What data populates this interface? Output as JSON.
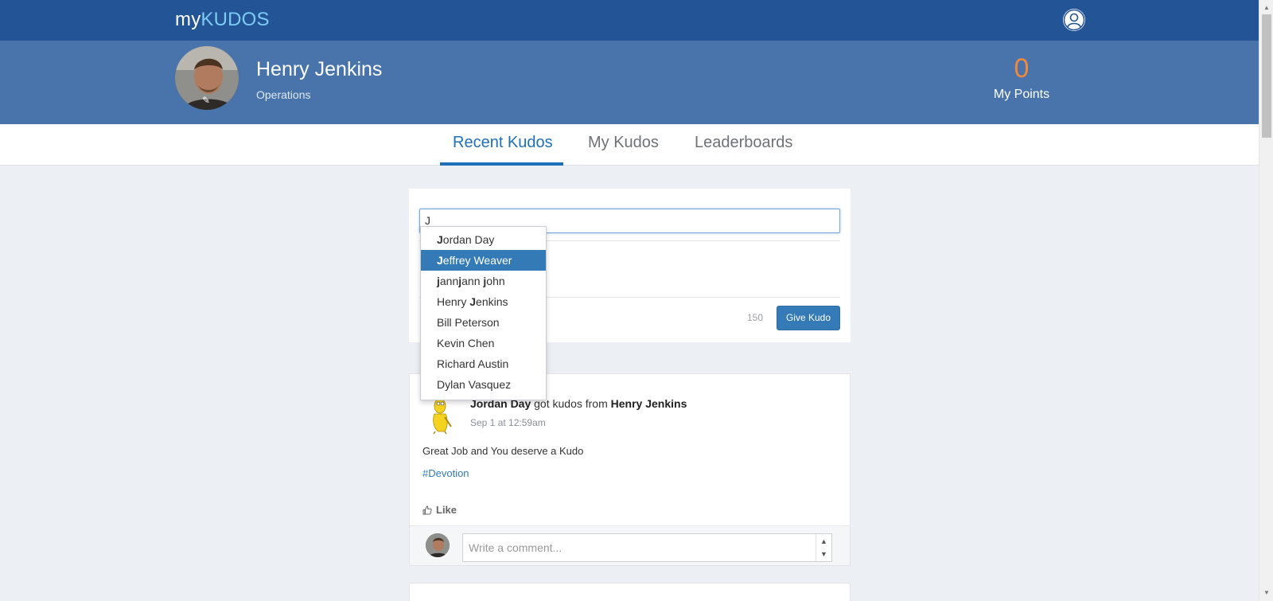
{
  "header": {
    "brand_prefix": "my",
    "brand_accent": "KUDOS",
    "user_icon": "user-circle-icon"
  },
  "profile": {
    "name": "Henry Jenkins",
    "department": "Operations",
    "points_value": "0",
    "points_label": "My Points",
    "edit_icon": "pencil-icon"
  },
  "tabs": [
    {
      "label": "Recent Kudos",
      "active": true
    },
    {
      "label": "My Kudos",
      "active": false
    },
    {
      "label": "Leaderboards",
      "active": false
    }
  ],
  "give_kudo": {
    "input_value": "J",
    "char_count": "150",
    "button_label": "Give Kudo"
  },
  "autocomplete": {
    "query": "J",
    "selected_index": 1,
    "items": [
      {
        "segments": [
          {
            "t": "J",
            "b": true
          },
          {
            "t": "ordan Day",
            "b": false
          }
        ]
      },
      {
        "segments": [
          {
            "t": "J",
            "b": true
          },
          {
            "t": "effrey Weaver",
            "b": false
          }
        ]
      },
      {
        "segments": [
          {
            "t": "j",
            "b": true
          },
          {
            "t": "ann",
            "b": false
          },
          {
            "t": "j",
            "b": true
          },
          {
            "t": "ann ",
            "b": false
          },
          {
            "t": "j",
            "b": true
          },
          {
            "t": "ohn",
            "b": false
          }
        ]
      },
      {
        "segments": [
          {
            "t": "Henry ",
            "b": false
          },
          {
            "t": "J",
            "b": true
          },
          {
            "t": "enkins",
            "b": false
          }
        ]
      },
      {
        "segments": [
          {
            "t": "Bill Peterson",
            "b": false
          }
        ]
      },
      {
        "segments": [
          {
            "t": "Kevin Chen",
            "b": false
          }
        ]
      },
      {
        "segments": [
          {
            "t": "Richard Austin",
            "b": false
          }
        ]
      },
      {
        "segments": [
          {
            "t": "Dylan Vasquez",
            "b": false
          }
        ]
      }
    ]
  },
  "feed": {
    "recipient": "Jordan Day",
    "connector": "got kudos from",
    "giver": "Henry Jenkins",
    "timestamp": "Sep 1 at 12:59am",
    "message": "Great Job and You deserve a Kudo",
    "tag": "#Devotion",
    "like_label": "Like",
    "like_icon": "thumbs-up-icon",
    "comment_placeholder": "Write a comment..."
  },
  "colors": {
    "topbar": "#225496",
    "profile_band": "#4874ab",
    "accent": "#337ab7",
    "points": "#f0893b",
    "brand_accent": "#7ccbf3"
  }
}
